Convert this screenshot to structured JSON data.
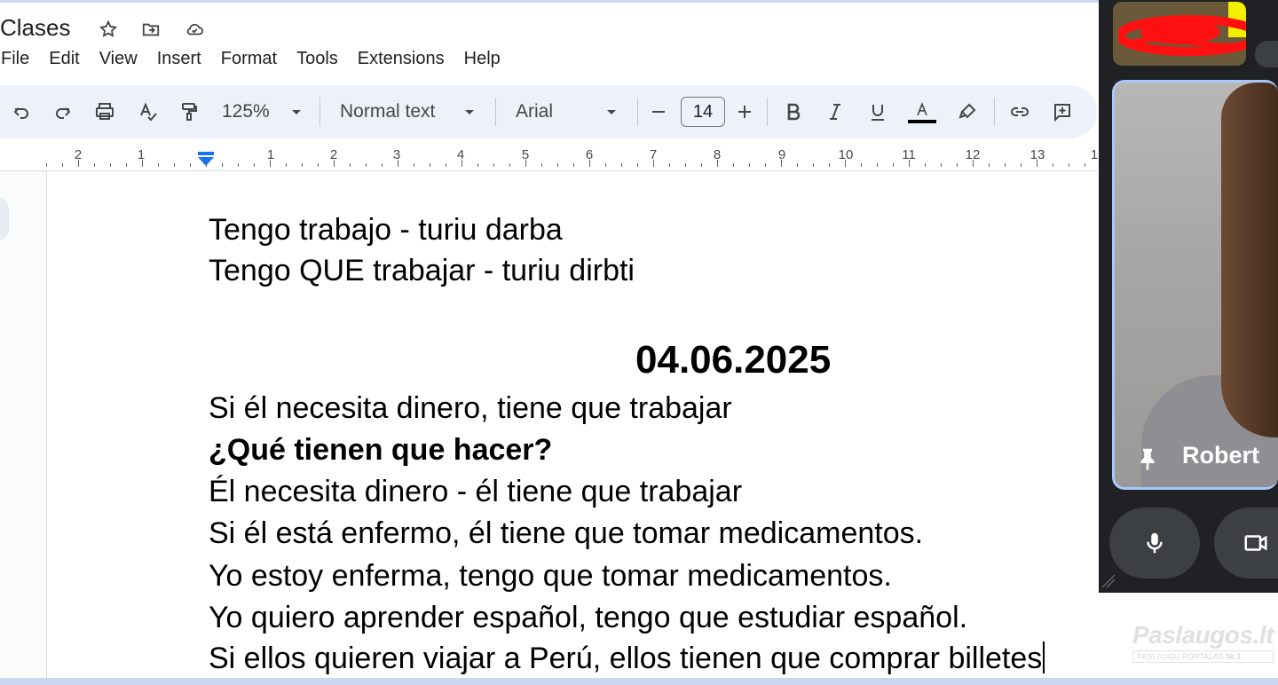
{
  "doc": {
    "title": "Clases",
    "title_icons": [
      "star-icon",
      "move-to-folder-icon",
      "cloud-saved-icon"
    ]
  },
  "menu": [
    "File",
    "Edit",
    "View",
    "Insert",
    "Format",
    "Tools",
    "Extensions",
    "Help"
  ],
  "toolbar": {
    "zoom": "125%",
    "style": "Normal text",
    "font": "Arial",
    "font_size": "14",
    "icons": [
      "undo-icon",
      "redo-icon",
      "print-icon",
      "spellcheck-icon",
      "paint-format-icon",
      "decrease-font-size-icon",
      "increase-font-size-icon",
      "bold-icon",
      "italic-icon",
      "underline-icon",
      "text-color-icon",
      "highlight-icon",
      "link-icon",
      "add-comment-icon"
    ],
    "text_color_swatch": "#000000"
  },
  "ruler": {
    "labels": [
      "2",
      "1",
      "1",
      "2",
      "3",
      "4",
      "5",
      "6",
      "7",
      "8",
      "9",
      "10",
      "11",
      "12",
      "13",
      "1"
    ]
  },
  "content": {
    "lines": [
      "Tengo trabajo - turiu darba",
      "Tengo QUE trabajar - turiu dirbti",
      "Si él necesita dinero, tiene que trabajar",
      "¿Qué tienen que hacer?",
      "Él necesita dinero - él tiene que trabajar",
      "Si él está enfermo, él tiene que tomar medicamentos.",
      "Yo estoy enferma, tengo que tomar medicamentos.",
      "Yo quiero aprender español, tengo que estudiar español.",
      "Si ellos quieren viajar a Perú, ellos tienen que comprar billetes"
    ],
    "date_heading": "04.06.2025"
  },
  "meet": {
    "participant_name": "Robert",
    "icons": [
      "pin-icon",
      "microphone-icon",
      "camera-icon"
    ],
    "accent": "#a8c7fa"
  },
  "watermark": {
    "main": "Paslaugos.lt",
    "sub": "PASLAUGŲ PORTALAS",
    "badge": "Nr.1"
  }
}
